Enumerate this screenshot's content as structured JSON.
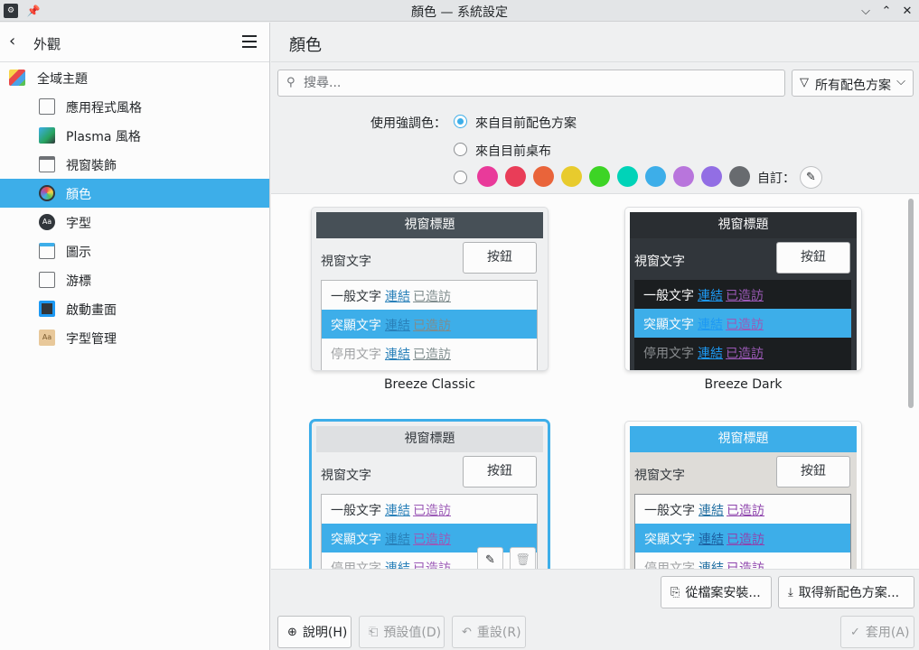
{
  "window": {
    "title": "顏色 — 系統設定"
  },
  "titlebar_buttons": {
    "minimize": "⌵",
    "maximize": "⌃",
    "close": "✕",
    "pin": "📌"
  },
  "sidebar": {
    "back_label": "外觀",
    "items": [
      {
        "label": "全域主題",
        "icon": "global-theme-icon"
      },
      {
        "label": "應用程式風格",
        "icon": "app-style-icon"
      },
      {
        "label": "Plasma 風格",
        "icon": "plasma-style-icon"
      },
      {
        "label": "視窗裝飾",
        "icon": "window-decoration-icon"
      },
      {
        "label": "顏色",
        "icon": "colors-icon"
      },
      {
        "label": "字型",
        "icon": "fonts-icon"
      },
      {
        "label": "圖示",
        "icon": "icons-icon"
      },
      {
        "label": "游標",
        "icon": "cursors-icon"
      },
      {
        "label": "啟動畫面",
        "icon": "splash-screen-icon"
      },
      {
        "label": "字型管理",
        "icon": "font-management-icon"
      }
    ]
  },
  "main": {
    "page_title": "顏色",
    "search": {
      "placeholder": "搜尋..."
    },
    "filter": {
      "label": "所有配色方案"
    },
    "accent": {
      "label": "使用強調色：",
      "option_scheme": "來自目前配色方案",
      "option_wallpaper": "來自目前桌布",
      "custom_label": "自訂：",
      "swatches": [
        "#e93a9a",
        "#e93d58",
        "#e9643a",
        "#e8cb2d",
        "#3dd425",
        "#00d3b8",
        "#3daee9",
        "#b875dc",
        "#926ee4",
        "#686b6f"
      ]
    },
    "preview": {
      "title": "視窗標題",
      "window_text": "視窗文字",
      "button": "按鈕",
      "normal_text": "一般文字",
      "highlight_text": "突顯文字",
      "inactive_text": "停用文字",
      "link": "連結",
      "visited": "已造訪"
    },
    "schemes": [
      {
        "name": "Breeze Classic"
      },
      {
        "name": "Breeze Dark"
      },
      {
        "name": ""
      },
      {
        "name": ""
      }
    ],
    "actions": {
      "install_file": "從檔案安裝...",
      "get_new": "取得新配色方案..."
    }
  },
  "footer": {
    "help": "說明(H)",
    "defaults": "預設值(D)",
    "reset": "重設(R)",
    "apply": "套用(A)"
  }
}
